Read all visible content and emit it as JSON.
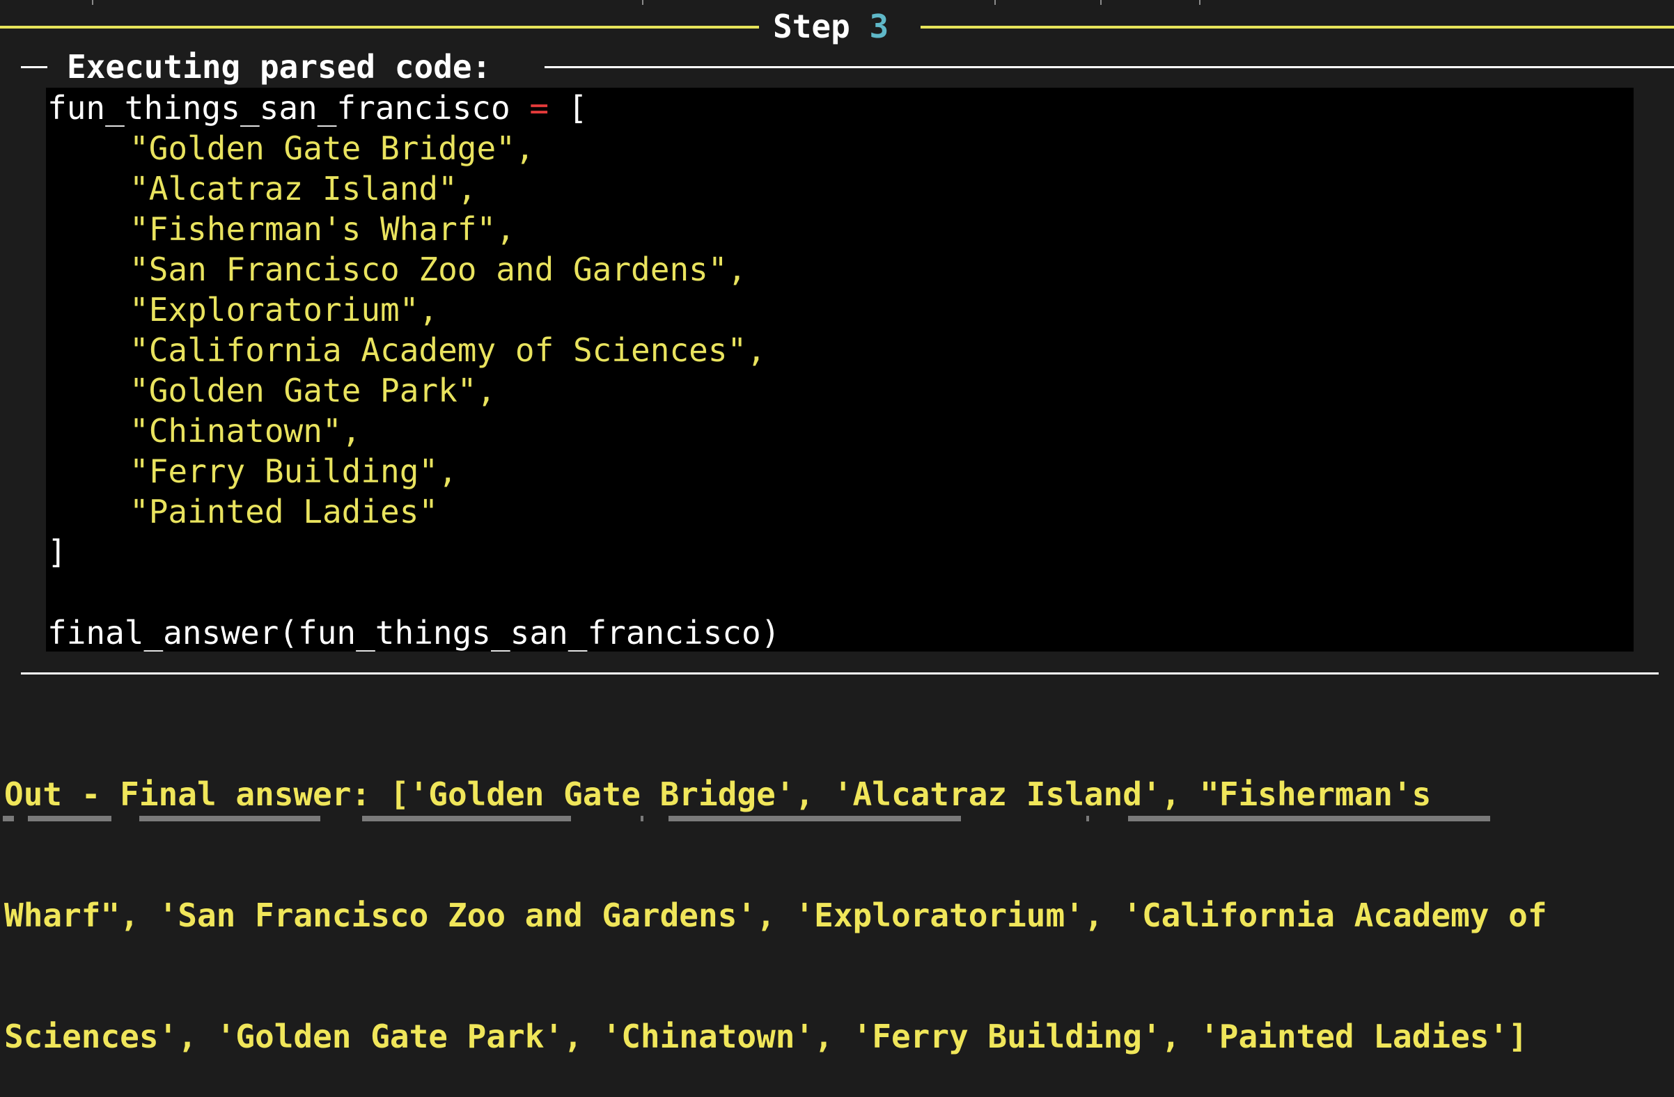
{
  "step": {
    "label": "Step",
    "number": "3"
  },
  "section": {
    "title": "Executing parsed code:"
  },
  "code": {
    "var_name": "fun_things_san_francisco",
    "assign_op": "=",
    "open_bracket": "[",
    "items": [
      "\"Golden Gate Bridge\",",
      "\"Alcatraz Island\",",
      "\"Fisherman's Wharf\",",
      "\"San Francisco Zoo and Gardens\",",
      "\"Exploratorium\",",
      "\"California Academy of Sciences\",",
      "\"Golden Gate Park\",",
      "\"Chinatown\",",
      "\"Ferry Building\",",
      "\"Painted Ladies\""
    ],
    "close_bracket": "]",
    "call": "final_answer(fun_things_san_francisco)"
  },
  "output": {
    "lines": [
      "Out - Final answer: ['Golden Gate Bridge', 'Alcatraz Island', \"Fisherman's",
      "Wharf\", 'San Francisco Zoo and Gardens', 'Exploratorium', 'California Academy of",
      "Sciences', 'Golden Gate Park', 'Chinatown', 'Ferry Building', 'Painted Ladies']"
    ]
  },
  "colors": {
    "background": "#1c1c1c",
    "code_background": "#000000",
    "string": "#e9e35e",
    "operator": "#e23a3a",
    "step_number": "#5fb8c8",
    "rule_accent": "#e6e35a",
    "final_answer": "#f0e65a"
  }
}
